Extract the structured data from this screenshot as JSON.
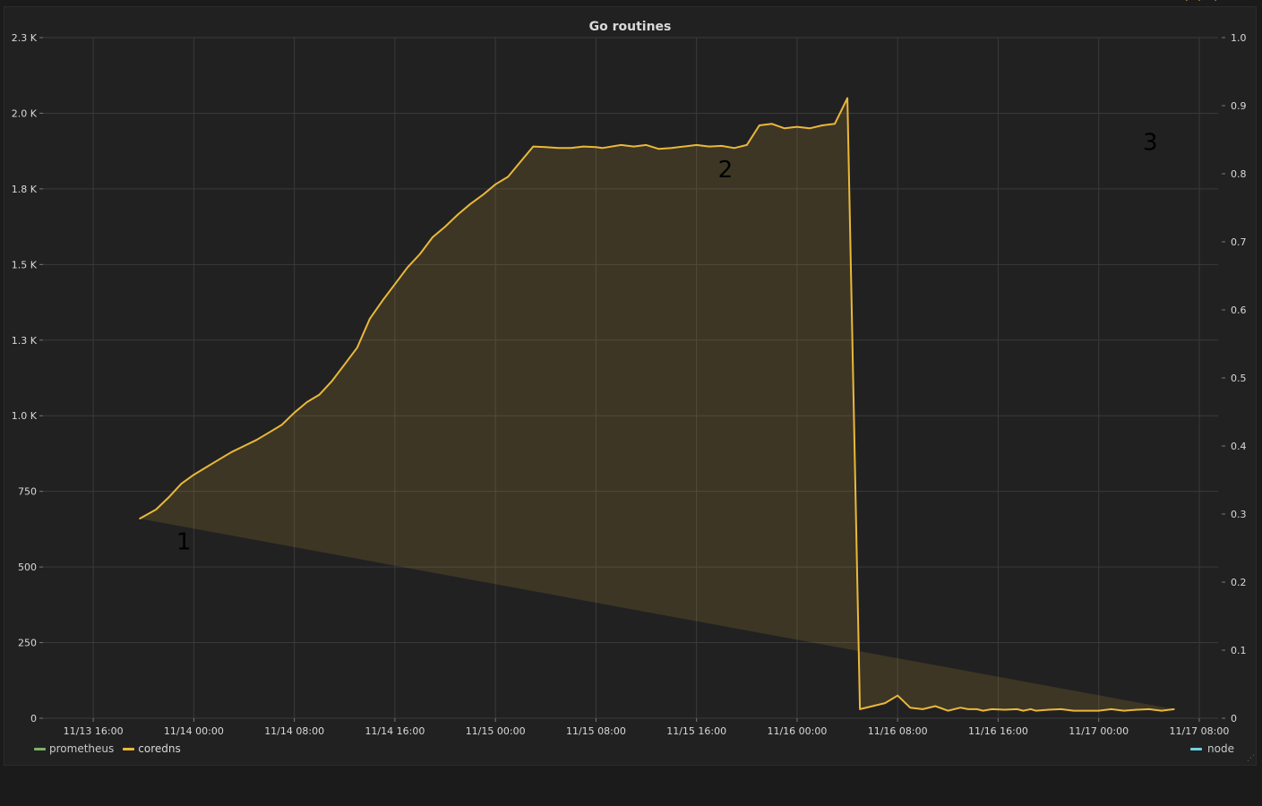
{
  "panel": {
    "title": "Go routines"
  },
  "chart_data": {
    "type": "area",
    "title": "Go routines",
    "x_ticks": [
      "11/13 16:00",
      "11/14 00:00",
      "11/14 08:00",
      "11/14 16:00",
      "11/15 00:00",
      "11/15 08:00",
      "11/15 16:00",
      "11/16 00:00",
      "11/16 08:00",
      "11/16 16:00",
      "11/17 00:00",
      "11/17 08:00"
    ],
    "x_range_hours": [
      -4,
      89.5
    ],
    "left_axis": {
      "ticks": [
        "0",
        "250",
        "500",
        "750",
        "1.0 K",
        "1.3 K",
        "1.5 K",
        "1.8 K",
        "2.0 K",
        "2.3 K"
      ],
      "ylim": [
        0,
        2250
      ]
    },
    "right_axis": {
      "ticks": [
        "0",
        "0.1",
        "0.2",
        "0.3",
        "0.4",
        "0.5",
        "0.6",
        "0.7",
        "0.8",
        "0.9",
        "1.0"
      ],
      "ylim": [
        0,
        1
      ]
    },
    "grid": true,
    "legend_position": "bottom",
    "series": [
      {
        "name": "prometheus",
        "color": "#7eb26d",
        "axis": "left",
        "x": [],
        "y": []
      },
      {
        "name": "coredns",
        "color": "#eab839",
        "axis": "left",
        "x_hours_since_11_13_16_00": [
          3.7,
          5,
          6,
          7,
          8,
          9,
          10,
          11,
          12,
          13,
          14,
          15,
          16,
          17,
          18,
          19,
          20,
          21,
          22,
          23,
          24,
          25,
          26,
          27,
          28,
          29,
          30,
          31,
          32,
          33,
          34,
          35,
          36,
          37,
          38,
          39,
          40,
          40.5,
          42,
          43,
          44,
          45,
          46,
          47,
          48,
          49,
          50,
          51,
          52,
          53,
          54,
          55,
          56,
          57,
          58,
          59,
          60,
          61,
          62,
          63,
          64,
          65,
          66,
          67,
          68,
          69,
          69.6,
          70.3,
          70.8,
          71.5,
          72.5,
          73.5,
          74,
          74.6,
          75,
          76,
          77,
          78,
          79,
          80,
          81,
          82,
          83,
          84,
          85,
          86,
          87,
          88,
          89.3
        ],
        "y": [
          660,
          690,
          730,
          775,
          805,
          830,
          855,
          880,
          900,
          920,
          945,
          970,
          1010,
          1045,
          1070,
          1115,
          1170,
          1225,
          1320,
          1380,
          1435,
          1490,
          1535,
          1590,
          1625,
          1665,
          1700,
          1730,
          1765,
          1790,
          1840,
          1890,
          1888,
          1885,
          1885,
          1890,
          1888,
          1885,
          1895,
          1890,
          1895,
          1882,
          1885,
          1890,
          1895,
          1890,
          1892,
          1885,
          1895,
          1960,
          1965,
          1950,
          1955,
          1950,
          1960,
          1965,
          2050,
          30,
          40,
          50,
          75,
          35,
          30,
          40,
          25,
          35,
          30,
          30,
          25,
          30,
          28,
          30,
          25,
          30,
          25,
          28,
          30,
          25,
          25,
          25,
          30,
          25,
          28,
          30,
          25,
          30
        ],
        "annotations": [
          "1",
          "2",
          "3"
        ]
      },
      {
        "name": "node",
        "color": "#6ed0e0",
        "axis": "right",
        "x": [],
        "y": []
      }
    ]
  },
  "legend": {
    "left": [
      {
        "name": "prometheus",
        "color": "#7eb26d"
      },
      {
        "name": "coredns",
        "color": "#eab839"
      }
    ],
    "right": {
      "name": "node",
      "color": "#6ed0e0"
    }
  },
  "annotations": [
    "1",
    "2",
    "3"
  ],
  "icons": {
    "resize": "resize-handle-icon"
  }
}
